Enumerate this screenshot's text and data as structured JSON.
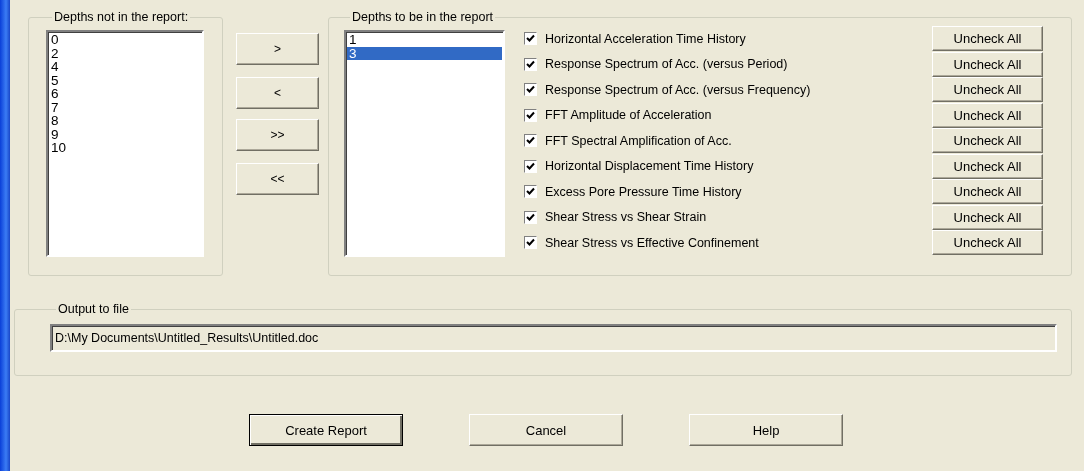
{
  "depths_not_in_report": {
    "label": "Depths not in the report:",
    "items": [
      {
        "text": "0",
        "selected": false
      },
      {
        "text": "2",
        "selected": false
      },
      {
        "text": "4",
        "selected": false
      },
      {
        "text": "5",
        "selected": false
      },
      {
        "text": "6",
        "selected": false
      },
      {
        "text": "7",
        "selected": false
      },
      {
        "text": "8",
        "selected": false
      },
      {
        "text": "9",
        "selected": false
      },
      {
        "text": "10",
        "selected": false
      }
    ]
  },
  "move_buttons": [
    ">",
    "<",
    ">>",
    "<<"
  ],
  "depths_in_report": {
    "label": "Depths to be in the report",
    "items": [
      {
        "text": "1",
        "selected": false
      },
      {
        "text": "3",
        "selected": true
      }
    ],
    "plots": [
      {
        "label": "Horizontal Acceleration Time History",
        "checked": true,
        "button": "Uncheck All"
      },
      {
        "label": "Response Spectrum of Acc. (versus Period)",
        "checked": true,
        "button": "Uncheck All"
      },
      {
        "label": "Response Spectrum of Acc. (versus Frequency)",
        "checked": true,
        "button": "Uncheck All"
      },
      {
        "label": "FFT Amplitude of Acceleration",
        "checked": true,
        "button": "Uncheck All"
      },
      {
        "label": "FFT Spectral Amplification of Acc.",
        "checked": true,
        "button": "Uncheck All"
      },
      {
        "label": "Horizontal Displacement Time History",
        "checked": true,
        "button": "Uncheck All"
      },
      {
        "label": "Excess Pore Pressure Time History",
        "checked": true,
        "button": "Uncheck All"
      },
      {
        "label": "Shear Stress vs Shear Strain",
        "checked": true,
        "button": "Uncheck All"
      },
      {
        "label": "Shear Stress vs Effective Confinement",
        "checked": true,
        "button": "Uncheck All"
      }
    ]
  },
  "output": {
    "label": "Output to file",
    "value": "D:\\My Documents\\Untitled_Results\\Untitled.doc"
  },
  "buttons": [
    {
      "label": "Create Report",
      "default": true
    },
    {
      "label": "Cancel",
      "default": false
    },
    {
      "label": "Help",
      "default": false
    }
  ]
}
